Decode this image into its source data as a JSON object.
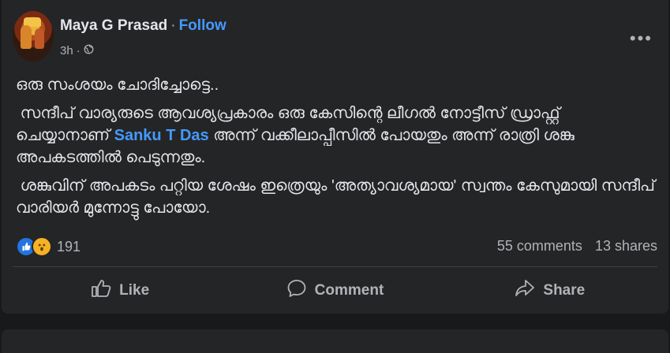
{
  "post": {
    "author": "Maya G Prasad",
    "separator": "·",
    "follow_label": "Follow",
    "time": "3h",
    "paragraph1": "ഒരു സംശയം ചോദിച്ചോട്ടെ..",
    "paragraph2_before_tag": "സന്ദീപ് വാര്യരുടെ ആവശ്യപ്രകാരം ഒരു കേസിന്റെ ലീഗൽ നോട്ടീസ് ഡ്രാഫ്റ്റ് ചെയ്യാനാണ് ",
    "tag_name": "Sanku T Das",
    "paragraph2_after_tag": " അന്ന് വക്കീലാപ്പീസിൽ പോയതും അന്ന് രാത്രി ശങ്കു അപകടത്തിൽ പെടുന്നതും.",
    "paragraph3": "ശങ്കുവിന് അപകടം പറ്റിയ ശേഷം ഇത്രെയും 'അത്യാവശ്യമായ' സ്വന്തം കേസുമായി സന്ദീപ് വാരിയർ മുന്നോട്ടു പോയോ."
  },
  "stats": {
    "reaction_count": "191",
    "comments": "55 comments",
    "shares": "13 shares"
  },
  "actions": {
    "like_label": "Like",
    "comment_label": "Comment",
    "share_label": "Share"
  },
  "icons": {
    "avatar": "profile-photo",
    "privacy": "globe-icon",
    "more": "more-options-icon",
    "like": "thumbs-up-icon",
    "comment": "comment-bubble-icon",
    "share": "share-arrow-icon"
  },
  "colors": {
    "background": "#18191a",
    "card": "#242526",
    "text": "#e4e6eb",
    "secondary_text": "#b0b3b8",
    "link_blue": "#4599ff",
    "like_blue": "#2374e1",
    "wow_yellow": "#f7b125"
  }
}
